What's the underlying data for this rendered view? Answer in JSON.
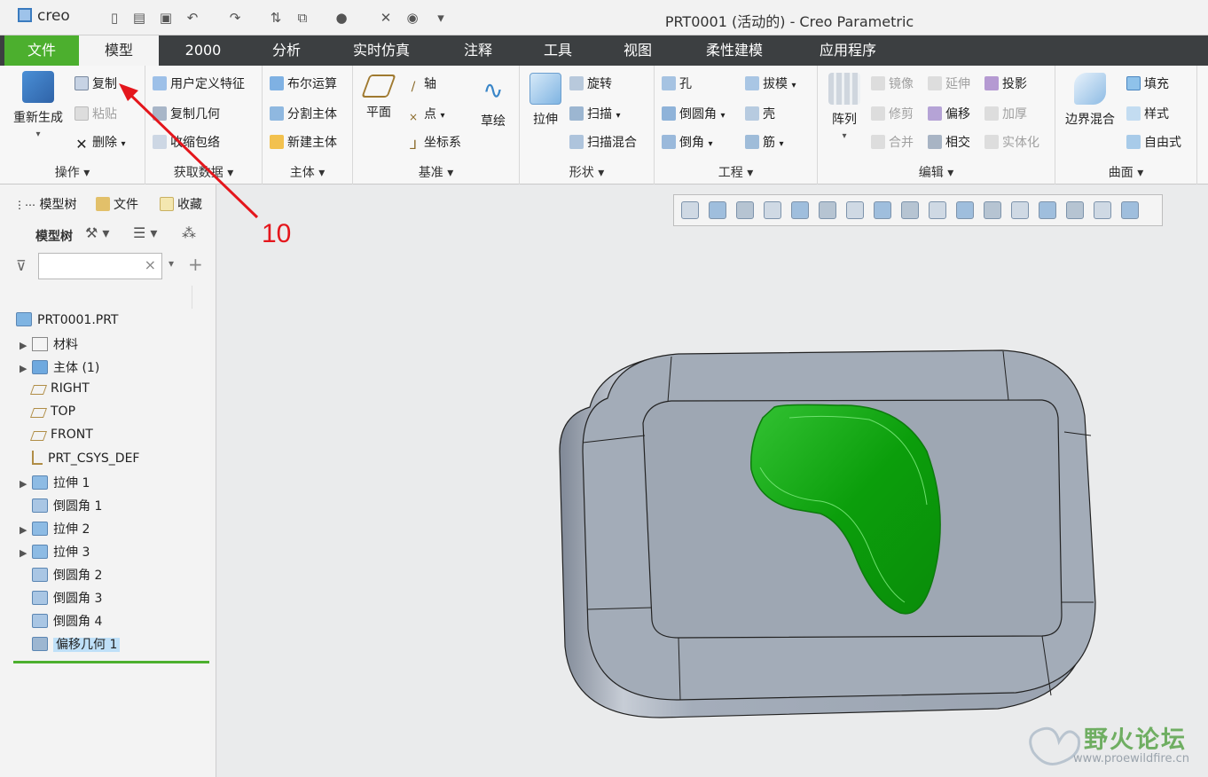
{
  "app": {
    "logo_text": "creo",
    "window_title": "PRT0001 (活动的) - Creo Parametric"
  },
  "tabs": [
    {
      "label": "文件"
    },
    {
      "label": "模型"
    },
    {
      "label": "2000"
    },
    {
      "label": "分析"
    },
    {
      "label": "实时仿真"
    },
    {
      "label": "注释"
    },
    {
      "label": "工具"
    },
    {
      "label": "视图"
    },
    {
      "label": "柔性建模"
    },
    {
      "label": "应用程序"
    }
  ],
  "ribbon": {
    "operations": {
      "label": "操作 ▾",
      "regenerate": "重新生成",
      "copy": "复制",
      "paste": "粘贴",
      "delete": "删除"
    },
    "get_data": {
      "label": "获取数据 ▾",
      "udf": "用户定义特征",
      "copy_geom": "复制几何",
      "shrinkwrap": "收缩包络"
    },
    "body": {
      "label": "主体 ▾",
      "boolean": "布尔运算",
      "split": "分割主体",
      "new_body": "新建主体"
    },
    "datum": {
      "label": "基准 ▾",
      "plane": "平面",
      "axis": "轴",
      "point": "点",
      "csys": "坐标系",
      "sketch": "草绘"
    },
    "shapes": {
      "label": "形状 ▾",
      "extrude": "拉伸",
      "revolve": "旋转",
      "sweep": "扫描",
      "swept_blend": "扫描混合"
    },
    "engineering": {
      "label": "工程 ▾",
      "hole": "孔",
      "round": "倒圆角",
      "chamfer": "倒角",
      "draft": "拔模",
      "shell": "壳",
      "rib": "筋"
    },
    "editing": {
      "label": "编辑 ▾",
      "pattern": "阵列",
      "mirror": "镜像",
      "trim": "修剪",
      "merge": "合并",
      "extend": "延伸",
      "offset": "偏移",
      "intersect": "相交",
      "project": "投影",
      "thicken": "加厚",
      "solidify": "实体化"
    },
    "surfaces": {
      "label": "曲面 ▾",
      "boundary_blend": "边界混合",
      "fill": "填充",
      "style": "样式",
      "freestyle": "自由式"
    }
  },
  "left_panel": {
    "tab_model_tree": "模型树",
    "tab_folder": "文件",
    "tab_favorites": "收藏",
    "toolbar_label": "模型树",
    "search_clear": "×",
    "tree": [
      {
        "label": "PRT0001.PRT",
        "icon": "part-icon",
        "expandable": false
      },
      {
        "label": "材料",
        "icon": "material-icon",
        "expandable": true
      },
      {
        "label": "主体 (1)",
        "icon": "body-icon",
        "expandable": true
      },
      {
        "label": "RIGHT",
        "icon": "datum-plane-icon",
        "expandable": false
      },
      {
        "label": "TOP",
        "icon": "datum-plane-icon",
        "expandable": false
      },
      {
        "label": "FRONT",
        "icon": "datum-plane-icon",
        "expandable": false
      },
      {
        "label": "PRT_CSYS_DEF",
        "icon": "csys-icon",
        "expandable": false
      },
      {
        "label": "拉伸 1",
        "icon": "extrude-icon",
        "expandable": true
      },
      {
        "label": "倒圆角 1",
        "icon": "round-icon",
        "expandable": false
      },
      {
        "label": "拉伸 2",
        "icon": "extrude-icon",
        "expandable": true
      },
      {
        "label": "拉伸 3",
        "icon": "extrude-icon",
        "expandable": true
      },
      {
        "label": "倒圆角 2",
        "icon": "round-icon",
        "expandable": false
      },
      {
        "label": "倒圆角 3",
        "icon": "round-icon",
        "expandable": false
      },
      {
        "label": "倒圆角 4",
        "icon": "round-icon",
        "expandable": false
      },
      {
        "label": "偏移几何 1",
        "icon": "offset-geometry-icon",
        "expandable": false,
        "selected": true
      }
    ]
  },
  "annotation": {
    "number": "10"
  },
  "watermark": {
    "title": "野火论坛",
    "url": "www.proewildfire.cn"
  },
  "colors": {
    "accent_green": "#4caf2e",
    "model_gray": "#a3acb8",
    "highlight_green": "#0aa70a",
    "annotation_red": "#e4161c"
  }
}
